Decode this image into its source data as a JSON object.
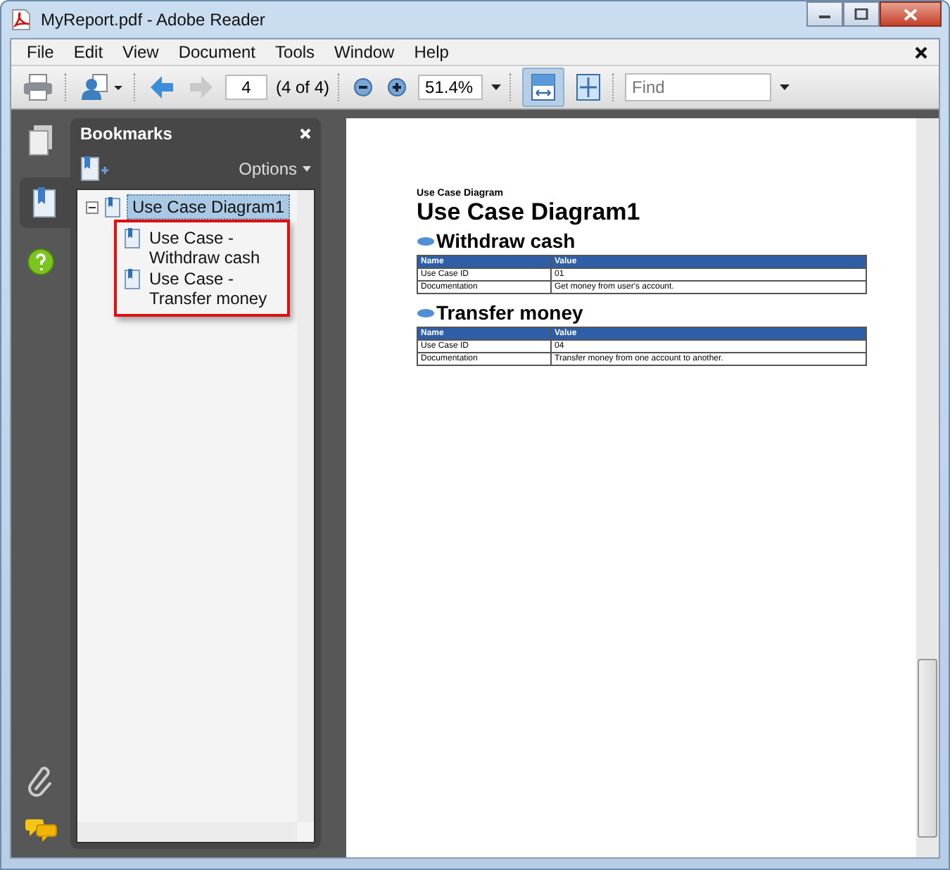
{
  "window": {
    "title": "MyReport.pdf - Adobe Reader"
  },
  "menu": [
    "File",
    "Edit",
    "View",
    "Document",
    "Tools",
    "Window",
    "Help"
  ],
  "toolbar": {
    "page_number": "4",
    "page_count": "(4 of 4)",
    "zoom": "51.4%",
    "find": {
      "placeholder": "Find"
    },
    "fit_width_selected": true
  },
  "bookmarks": {
    "title": "Bookmarks",
    "options": "Options",
    "tree": [
      {
        "label": "Use Case Diagram1",
        "selected": true,
        "expanded": true,
        "children": [
          {
            "label": "Use Case - Withdraw cash",
            "selected": false
          },
          {
            "label": "Use Case - Transfer money",
            "selected": false
          }
        ]
      }
    ]
  },
  "document": {
    "kicker": "Use Case Diagram",
    "title": "Use Case Diagram1",
    "sections": [
      {
        "heading": "Withdraw cash",
        "columns": [
          "Name",
          "Value"
        ],
        "rows": [
          [
            "Use Case ID",
            "01"
          ],
          [
            "Documentation",
            "Get money from user's account."
          ]
        ]
      },
      {
        "heading": "Transfer money",
        "columns": [
          "Name",
          "Value"
        ],
        "rows": [
          [
            "Use Case ID",
            "04"
          ],
          [
            "Documentation",
            "Transfer money from one account to another."
          ]
        ]
      }
    ]
  }
}
